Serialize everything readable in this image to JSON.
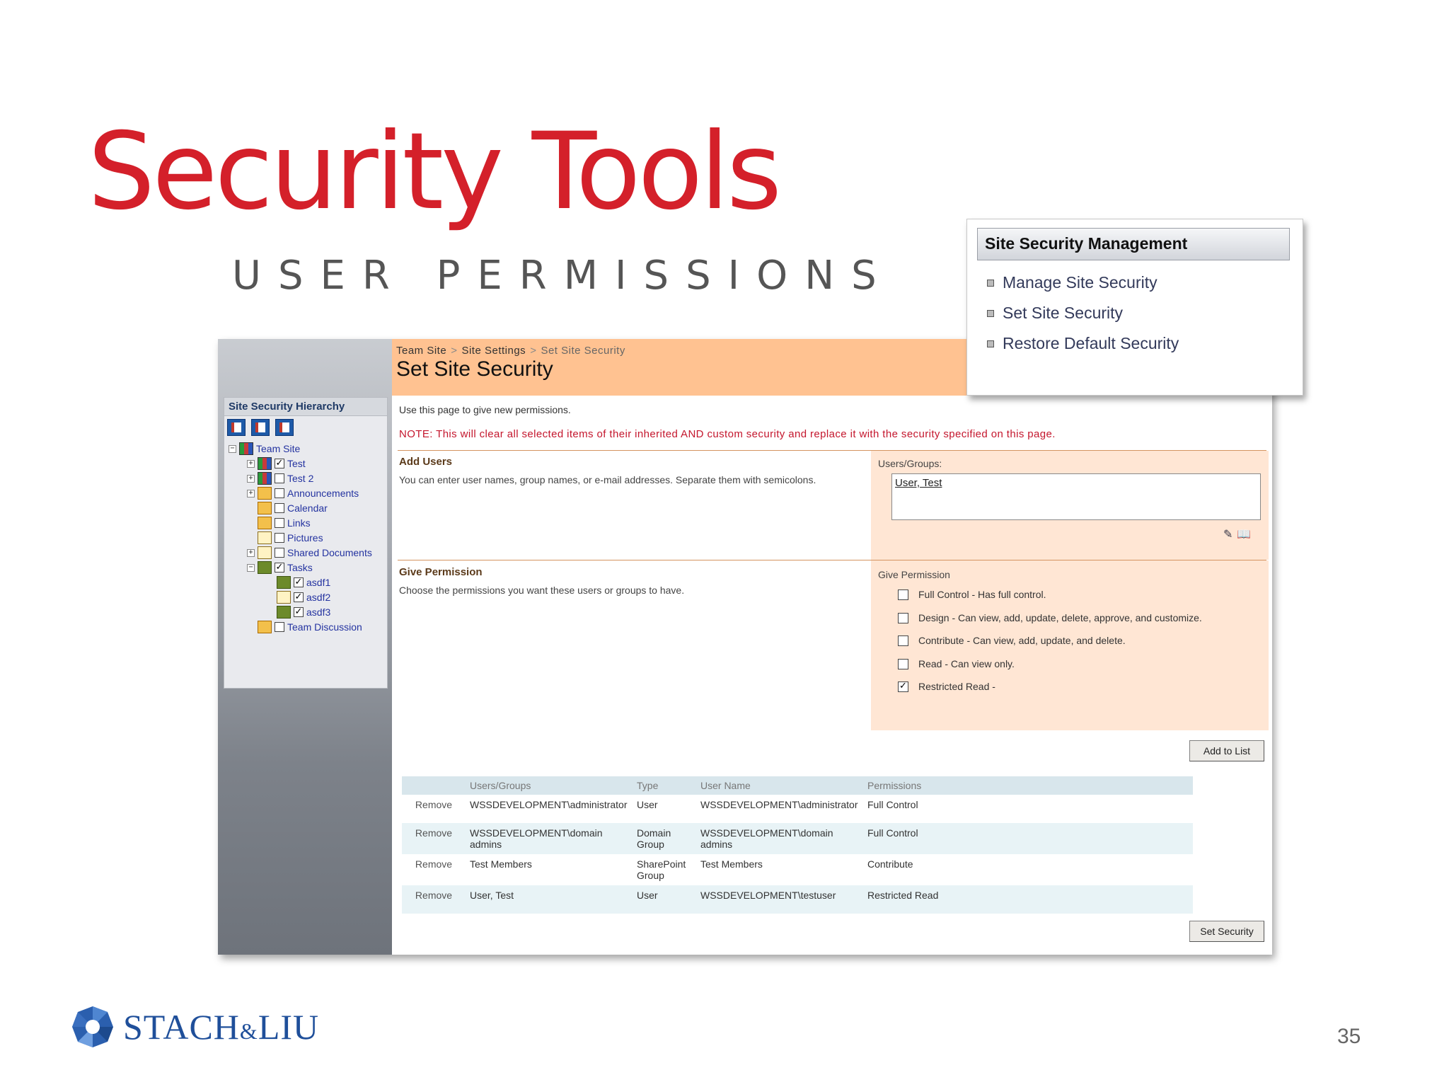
{
  "slide": {
    "title": "Security Tools",
    "subtitle": "USER PERMISSIONS",
    "page_number": "35"
  },
  "logo": {
    "name_left": "STACH",
    "amp": "&",
    "name_right": "LIU"
  },
  "popup": {
    "title": "Site Security Management",
    "items": [
      "Manage Site Security",
      "Set Site Security",
      "Restore Default Security"
    ]
  },
  "hierarchy": {
    "title": "Site Security Hierarchy",
    "items": [
      {
        "label": "Team Site",
        "checked": false
      },
      {
        "label": "Test",
        "checked": true
      },
      {
        "label": "Test 2",
        "checked": false
      },
      {
        "label": "Announcements",
        "checked": false
      },
      {
        "label": "Calendar",
        "checked": false
      },
      {
        "label": "Links",
        "checked": false
      },
      {
        "label": "Pictures",
        "checked": false
      },
      {
        "label": "Shared Documents",
        "checked": false
      },
      {
        "label": "Tasks",
        "checked": true
      },
      {
        "label": "asdf1",
        "checked": true
      },
      {
        "label": "asdf2",
        "checked": true
      },
      {
        "label": "asdf3",
        "checked": true
      },
      {
        "label": "Team Discussion",
        "checked": false
      }
    ]
  },
  "page": {
    "breadcrumb": [
      "Team Site",
      "Site Settings",
      "Set Site Security"
    ],
    "breadcrumb_sep": ">",
    "title": "Set Site Security",
    "intro": "Use this page to give new permissions.",
    "note": "NOTE: This will clear all selected items of their inherited AND custom security and replace it with the security specified on this page."
  },
  "add_users": {
    "heading": "Add Users",
    "description": "You can enter user names, group names, or e-mail addresses. Separate them with semicolons.",
    "field_label": "Users/Groups:",
    "value": "User, Test"
  },
  "give_permission": {
    "heading": "Give Permission",
    "description": "Choose the permissions you want these users or groups to have.",
    "field_label": "Give Permission",
    "options": [
      {
        "label": "Full Control - Has full control.",
        "checked": false
      },
      {
        "label": "Design - Can view, add, update, delete, approve, and customize.",
        "checked": false
      },
      {
        "label": "Contribute - Can view, add, update, and delete.",
        "checked": false
      },
      {
        "label": "Read - Can view only.",
        "checked": false
      },
      {
        "label": "Restricted Read -",
        "checked": true
      }
    ]
  },
  "buttons": {
    "add_to_list": "Add to List",
    "set_security": "Set Security"
  },
  "table": {
    "headers": [
      "",
      "Users/Groups",
      "Type",
      "User Name",
      "Permissions"
    ],
    "rows": [
      {
        "action": "Remove",
        "user": "WSSDEVELOPMENT\\administrator",
        "type": "User",
        "user_name": "WSSDEVELOPMENT\\administrator",
        "permissions": "Full Control"
      },
      {
        "action": "Remove",
        "user": "WSSDEVELOPMENT\\domain admins",
        "type": "Domain Group",
        "user_name": "WSSDEVELOPMENT\\domain admins",
        "permissions": "Full Control"
      },
      {
        "action": "Remove",
        "user": "Test Members",
        "type": "SharePoint Group",
        "user_name": "Test Members",
        "permissions": "Contribute"
      },
      {
        "action": "Remove",
        "user": "User, Test",
        "type": "User",
        "user_name": "WSSDEVELOPMENT\\testuser",
        "permissions": "Restricted Read"
      }
    ]
  },
  "colors": {
    "title_red": "#d4202a",
    "banner": "#ffc291",
    "panel": "#ffe6d4",
    "link_blue": "#2433a0",
    "note_red": "#c4162d"
  }
}
